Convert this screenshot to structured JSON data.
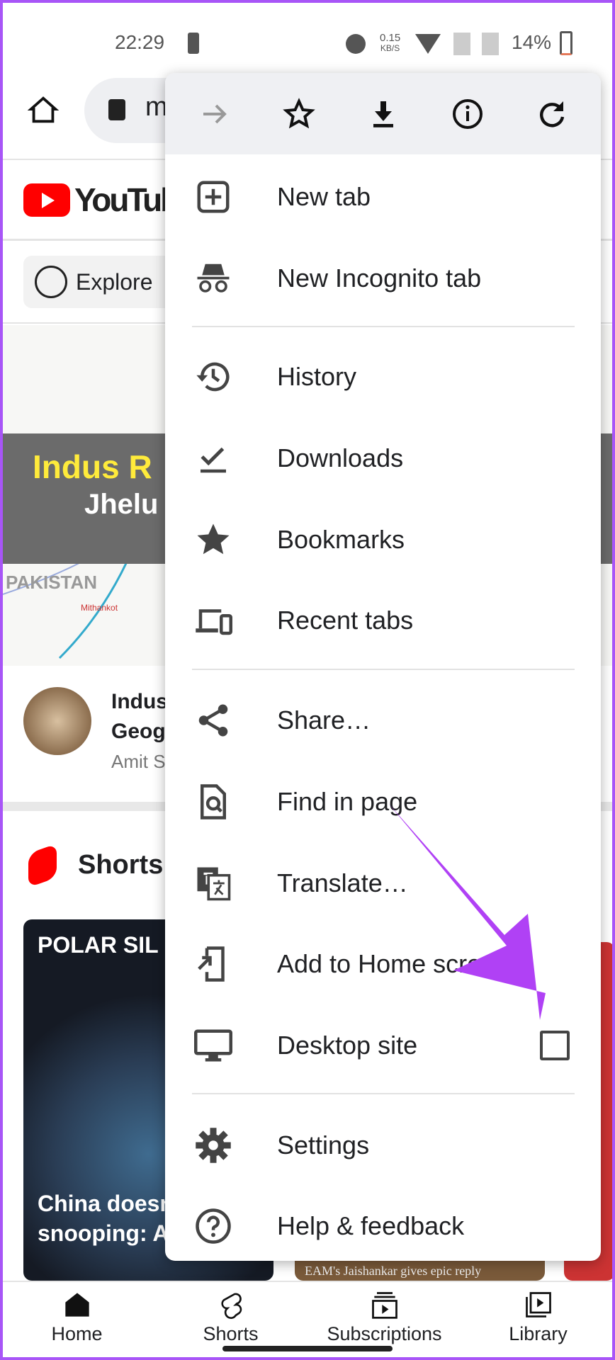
{
  "status_bar": {
    "time": "22:29",
    "net_speed": "0.15",
    "net_unit": "KB/S",
    "battery": "14%"
  },
  "address_bar": {
    "url_fragment": "m"
  },
  "page": {
    "logo_text": "YouTube",
    "explore_chip": "Explore",
    "video": {
      "banner_title": "Indus R",
      "banner_subtitle": "Jhelu",
      "map_label": "PAKISTAN",
      "map_label_2": "Mithankot",
      "title_line1": "Indus",
      "title_line2": "Geog",
      "channel": "Amit S"
    },
    "shorts_header": "Shorts",
    "shorts": [
      {
        "overlay": "POLAR SIL",
        "caption_line1": "China doesn",
        "caption_line2": "snooping: A"
      },
      {
        "caption": "EAM's Jaishankar gives epic reply"
      }
    ]
  },
  "menu": {
    "toolbar": [
      {
        "icon": "forward-arrow-icon",
        "enabled": false
      },
      {
        "icon": "star-icon"
      },
      {
        "icon": "download-icon"
      },
      {
        "icon": "info-icon"
      },
      {
        "icon": "reload-icon"
      }
    ],
    "items": [
      {
        "label": "New tab",
        "icon": "new-tab-icon"
      },
      {
        "label": "New Incognito tab",
        "icon": "incognito-icon"
      },
      {
        "label": "History",
        "icon": "history-icon"
      },
      {
        "label": "Downloads",
        "icon": "downloads-icon"
      },
      {
        "label": "Bookmarks",
        "icon": "bookmark-star-icon"
      },
      {
        "label": "Recent tabs",
        "icon": "devices-icon"
      },
      {
        "label": "Share…",
        "icon": "share-icon"
      },
      {
        "label": "Find in page",
        "icon": "find-in-page-icon"
      },
      {
        "label": "Translate…",
        "icon": "translate-icon"
      },
      {
        "label": "Add to Home screen",
        "icon": "add-to-home-icon"
      },
      {
        "label": "Desktop site",
        "icon": "monitor-icon",
        "checked": false
      },
      {
        "label": "Settings",
        "icon": "gear-icon"
      },
      {
        "label": "Help & feedback",
        "icon": "help-icon"
      }
    ]
  },
  "bottom_nav": [
    {
      "label": "Home"
    },
    {
      "label": "Shorts"
    },
    {
      "label": "Subscriptions"
    },
    {
      "label": "Library"
    }
  ],
  "colors": {
    "annotation_arrow": "#b041f5",
    "youtube_red": "#ff0000",
    "frame": "#a855f7"
  }
}
